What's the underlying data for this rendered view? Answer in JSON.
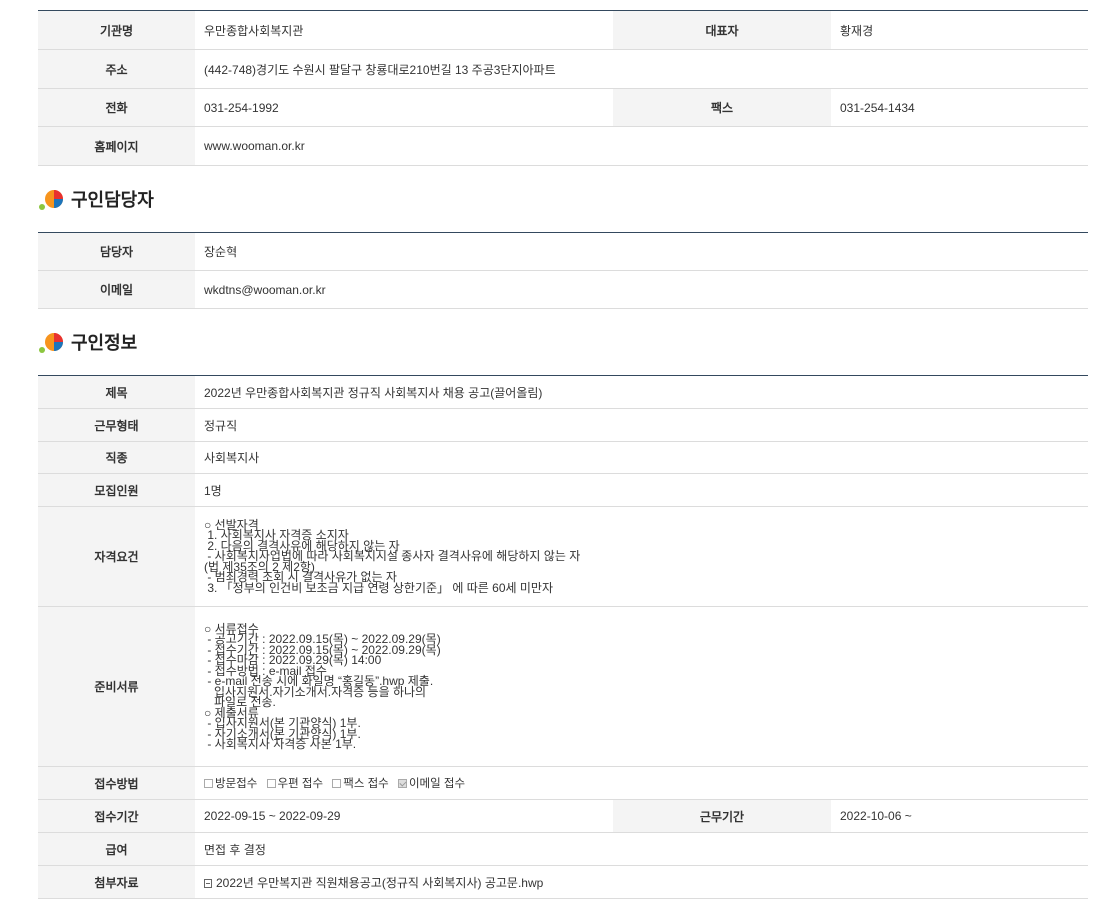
{
  "org": {
    "name_label": "기관명",
    "name": "우만종합사회복지관",
    "rep_label": "대표자",
    "rep": "황재경",
    "addr_label": "주소",
    "addr": "(442-748)경기도 수원시 팔달구 창룡대로210번길 13 주공3단지아파트",
    "tel_label": "전화",
    "tel": "031-254-1992",
    "fax_label": "팩스",
    "fax": "031-254-1434",
    "home_label": "홈페이지",
    "home": "www.wooman.or.kr"
  },
  "contact": {
    "title": "구인담당자",
    "person_label": "담당자",
    "person": "장순혁",
    "email_label": "이메일",
    "email": "wkdtns@wooman.or.kr"
  },
  "job": {
    "title": "구인정보",
    "subject_label": "제목",
    "subject": "2022년 우만종합사회복지관 정규직 사회복지사 채용 공고(끌어올림)",
    "type_label": "근무형태",
    "type": "정규직",
    "occ_label": "직종",
    "occ": "사회복지사",
    "count_label": "모집인원",
    "count": "1명",
    "qual_label": "자격요건",
    "qual_lines": [
      "○ 선발자격",
      " 1. 사회복지사 자격증 소지자",
      " 2. 다음의 결격사유에 해당하지 않는 자",
      " - 사회복지사업법에 따라 사회복지시설 종사자 결격사유에 해당하지 않는 자",
      "(법 제35조의 2 제2항)",
      " - 범죄경력 조회 시 결격사유가 없는 자",
      " 3. 「정부의 인건비 보조금 지급 연령 상한기준」 에 따른 60세 미만자"
    ],
    "docs_label": "준비서류",
    "docs_lines": [
      "○ 서류접수",
      " - 공고기간 : 2022.09.15(목) ~ 2022.09.29(목)",
      " - 접수기간 : 2022.09.15(목) ~ 2022.09.29(목)",
      " - 접수마감 : 2022.09.29(목) 14:00",
      " - 접수방법 : e-mail 접수",
      " - e-mail 전송 시에 화일명 “홍길동”.hwp 제출.",
      "   입사지원서.자기소개서.자격증 등을 하나의",
      "   파일로 전송.",
      "○ 제출서류",
      " - 입사지원서(본 기관양식) 1부.",
      " - 자기소개서(본 기관양식) 1부.",
      " - 사회복지사 자격증 사본 1부."
    ],
    "method_label": "접수방법",
    "methods": [
      {
        "label": "방문접수",
        "checked": false
      },
      {
        "label": "우편 접수",
        "checked": false
      },
      {
        "label": "팩스 접수",
        "checked": false
      },
      {
        "label": "이메일 접수",
        "checked": true
      }
    ],
    "period_label": "접수기간",
    "period": "2022-09-15 ~ 2022-09-29",
    "work_label": "근무기간",
    "work": "2022-10-06 ~",
    "pay_label": "급여",
    "pay": "면접 후 결정",
    "attach_label": "첨부자료",
    "attach": "2022년 우만복지관 직원채용공고(정규직 사회복지사) 공고문.hwp"
  }
}
